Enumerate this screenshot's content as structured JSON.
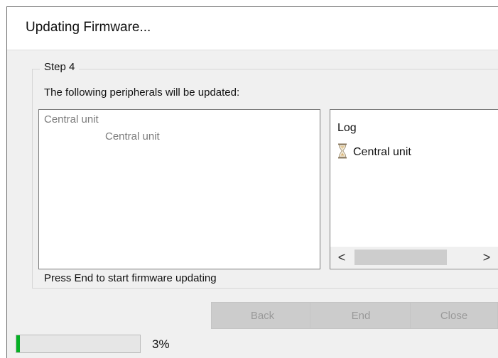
{
  "window": {
    "title": "Updating Firmware..."
  },
  "step": {
    "caption": "Step 4",
    "instruction": "The following peripherals will be updated:",
    "status": "Press End to start firmware updating"
  },
  "peripherals": {
    "items": [
      "Central unit",
      "Central unit"
    ]
  },
  "log": {
    "title": "Log",
    "entries": [
      {
        "icon": "hourglass-icon",
        "label": "Central unit"
      }
    ],
    "scroll_left_glyph": "<",
    "scroll_right_glyph": ">"
  },
  "buttons": {
    "back": "Back",
    "end": "End",
    "close": "Close"
  },
  "progress": {
    "value_fraction": 0.03,
    "label": "3%",
    "color": "#06b025"
  }
}
